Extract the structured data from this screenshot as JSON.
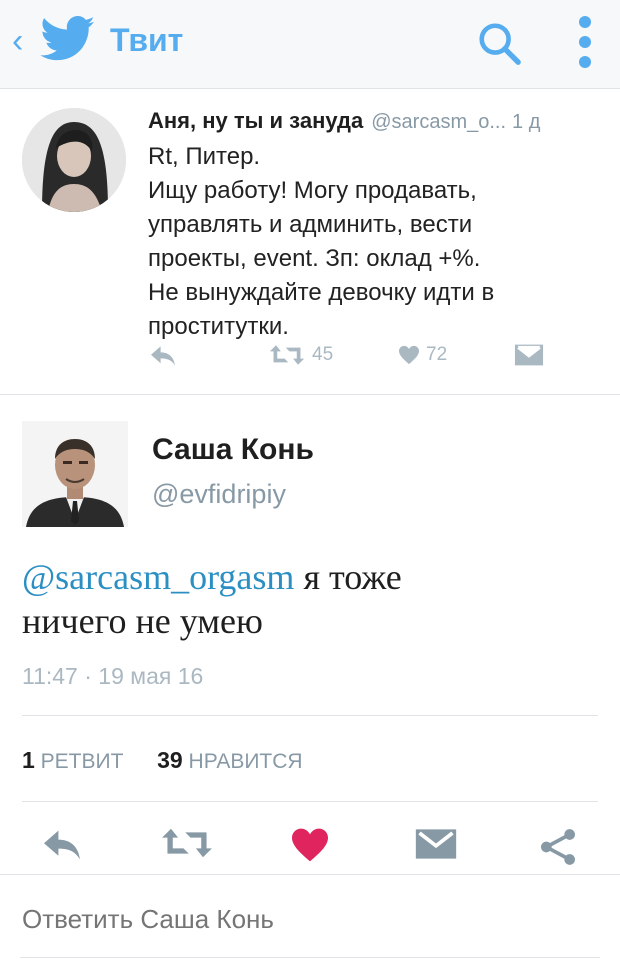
{
  "topbar": {
    "back_icon": "chevron-left-icon",
    "logo_icon": "twitter-bird-icon",
    "title": "Твит",
    "search_icon": "search-icon",
    "menu_icon": "more-vertical-icon",
    "accent_color": "#55acee"
  },
  "quoted_tweet": {
    "name": "Аня, ну ты и зануда",
    "handle": "@sarcasm_o...",
    "time": "1 д",
    "lines": [
      "Rt, Питер.",
      "Ищу работу! Могу продавать,",
      "управлять и админить, вести",
      "проекты, event. Зп: оклад +%.",
      "Не вынуждайте девочку идти в",
      "проститутки."
    ],
    "retweet_count": "45",
    "like_count": "72"
  },
  "tweet": {
    "name": "Саша Конь",
    "handle": "@evfidripiy",
    "mention": "@sarcasm_orgasm",
    "text_line1": " я тоже",
    "text_line2": "ничего не умею",
    "timestamp": "11:47 · 19 мая 16",
    "retweets": "1",
    "retweets_label": "РЕТВИТ",
    "likes": "39",
    "likes_label": "НРАВИТСЯ",
    "like_color": "#e0245e"
  },
  "reply": {
    "placeholder": "Ответить Саша Конь"
  }
}
